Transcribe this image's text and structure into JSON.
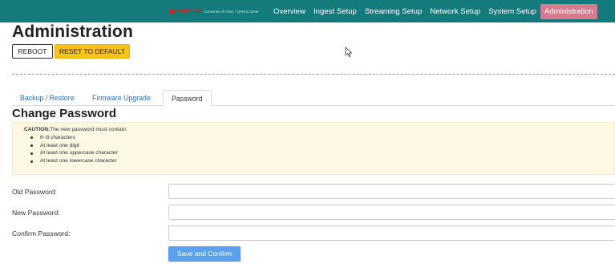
{
  "navbar": {
    "brand_logo": "LogicLink",
    "brand_tagline": "Converter of ATSC / QAM to QAM",
    "items": [
      {
        "label": "Overview",
        "active": false
      },
      {
        "label": "Ingest Setup",
        "active": false
      },
      {
        "label": "Streaming Setup",
        "active": false
      },
      {
        "label": "Network Setup",
        "active": false
      },
      {
        "label": "System Setup",
        "active": false
      },
      {
        "label": "Administration",
        "active": true
      }
    ],
    "colors": {
      "background": "#137b7b",
      "active": "#d87b90"
    }
  },
  "header": {
    "title": "Administration",
    "reboot_label": "REBOOT",
    "reset_label": "RESET TO DEFAULT"
  },
  "tabs": [
    {
      "label": "Backup / Restore",
      "active": false
    },
    {
      "label": "Firmware Upgrade",
      "active": false
    },
    {
      "label": "Password",
      "active": true
    }
  ],
  "section": {
    "title": "Change Password"
  },
  "caution": {
    "heading": "CAUTION:",
    "text": "The new password must contain:",
    "rules": [
      "6~8 characters",
      "At least one digit",
      "At least one uppercase character",
      "At least one lowercase character"
    ]
  },
  "form": {
    "old_password": {
      "label": "Old Password:",
      "value": "",
      "placeholder": ""
    },
    "new_password": {
      "label": "New Password:",
      "value": "",
      "placeholder": ""
    },
    "confirm_password": {
      "label": "Confirm Password:",
      "value": "",
      "placeholder": ""
    },
    "submit_label": "Save and Confirm"
  },
  "icons": {
    "cursor": "mouse-pointer-icon"
  }
}
